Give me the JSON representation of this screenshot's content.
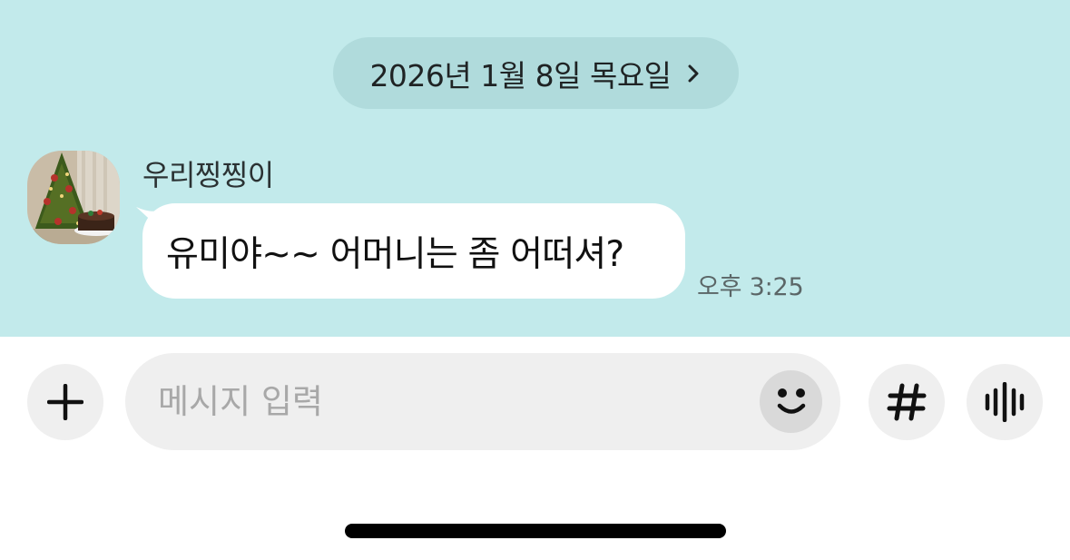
{
  "date_header": {
    "label": "2026년 1월 8일 목요일"
  },
  "message": {
    "sender": "우리찡찡이",
    "text": "유미야~~ 어머니는 좀 어떠셔?",
    "time": "오후 3:25"
  },
  "composer": {
    "placeholder": "메시지 입력"
  },
  "icons": {
    "date_chevron": "chevron-right-icon",
    "attach": "plus-icon",
    "emoji": "smiley-icon",
    "hashtag": "hashtag-icon",
    "voice": "voice-wave-icon"
  },
  "colors": {
    "chat_background": "#c2eaeb",
    "date_pill": "#b0dbdc",
    "bubble": "#ffffff",
    "composer_background": "#efefef"
  }
}
